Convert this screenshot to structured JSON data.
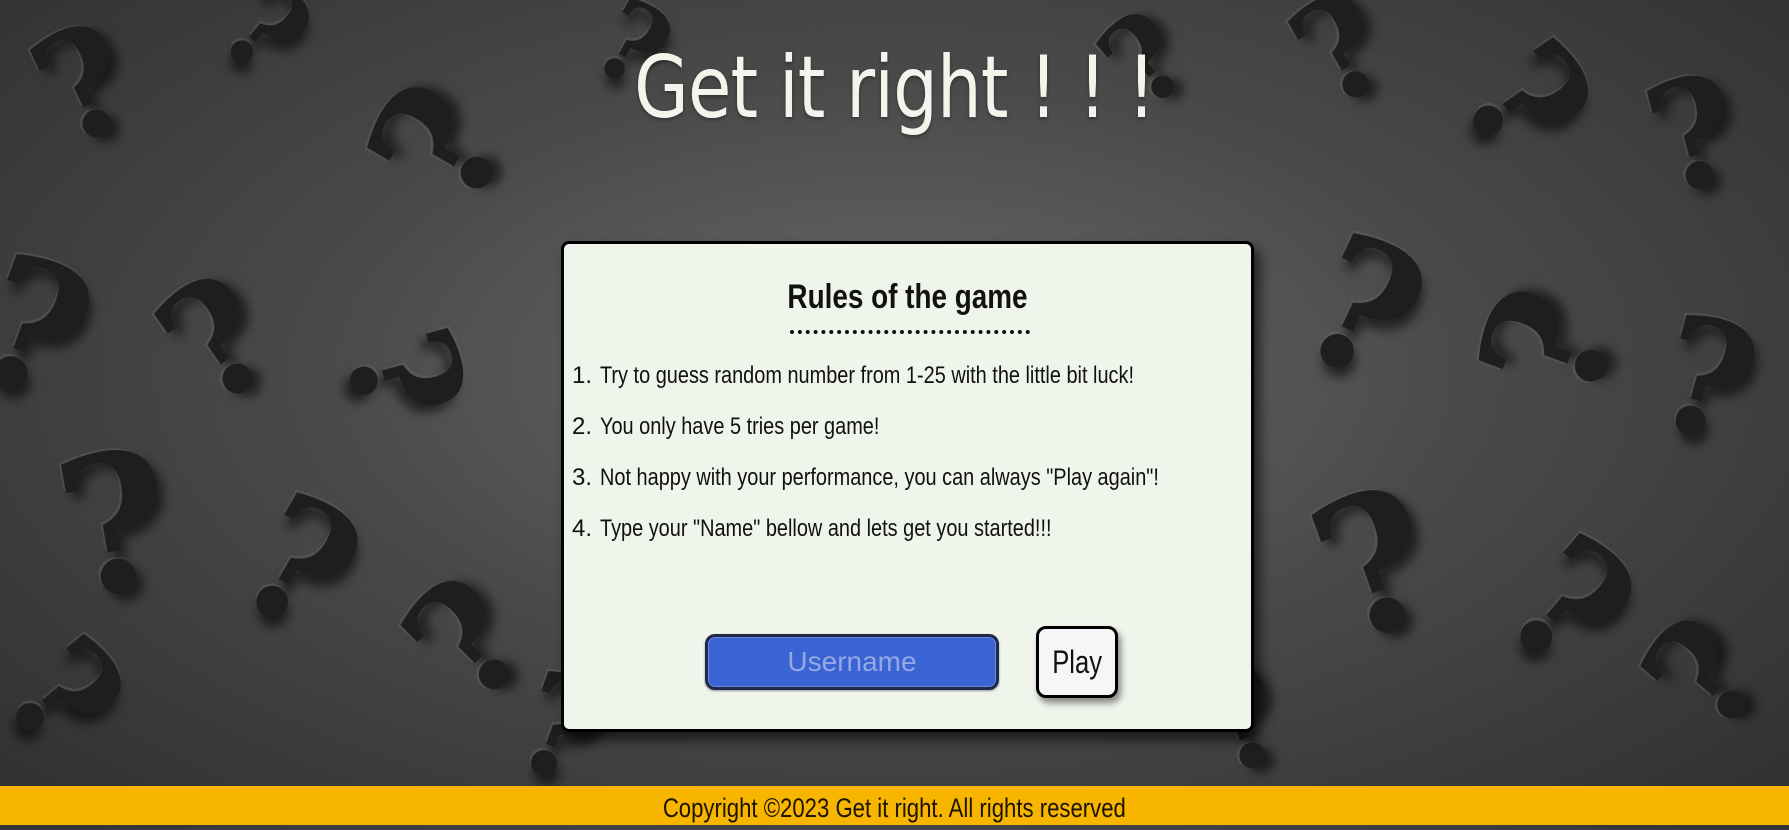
{
  "page": {
    "title": "Get it right ! ! !"
  },
  "rules": {
    "heading": "Rules of the game",
    "items": [
      {
        "num": "1.",
        "text": "Try to guess random number from 1-25 with the little bit luck!"
      },
      {
        "num": "2.",
        "text": "You only have 5 tries per game!"
      },
      {
        "num": "3.",
        "text": "Not happy with your performance, you can always \"Play again\"!"
      },
      {
        "num": "4.",
        "text": "Type your \"Name\" bellow and lets get you started!!!"
      }
    ]
  },
  "form": {
    "username_placeholder": "Username",
    "username_value": "",
    "play_label": "Play"
  },
  "footer": {
    "text": "Copyright ©2023 Get it right. All rights reserved"
  },
  "colors": {
    "card_background": "#f0f5ec",
    "input_background": "#3a63d4",
    "footer_background": "#f8b500",
    "title_color": "#f2f5ec"
  },
  "icons": {
    "background_pattern": "question-mark-icon"
  }
}
